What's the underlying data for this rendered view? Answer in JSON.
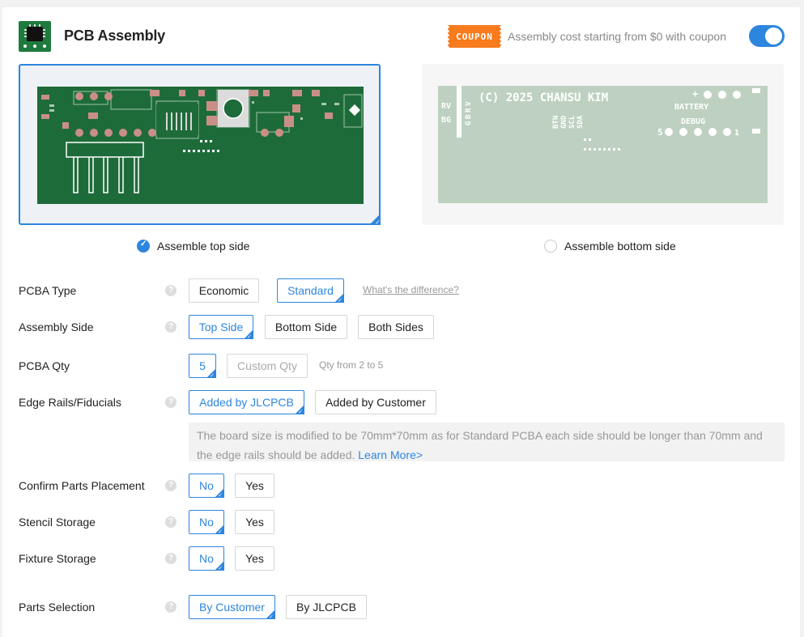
{
  "header": {
    "title": "PCB Assembly",
    "coupon_badge": "COUPON",
    "coupon_text": "Assembly cost starting from $0 with coupon",
    "toggle_on": true,
    "accent_color": "#2d86de",
    "coupon_color": "#f87b1e",
    "board_green": "#1e6b3a"
  },
  "boards": {
    "top_silkscreen": [],
    "bottom_silkscreen": {
      "copyright": "(C) 2025 CHANSU KIM",
      "left_labels": [
        "RV",
        "BG"
      ],
      "side_letters": [
        "V",
        "R",
        "B",
        "G"
      ],
      "vertical_labels": [
        "BTN",
        "GND",
        "SCL",
        "SDA"
      ],
      "battery": "BATTERY",
      "debug": "DEBUG",
      "plus_minus": "+  -",
      "num_left": "5",
      "num_right": "1"
    }
  },
  "side_select": {
    "top_label": "Assemble top side",
    "bottom_label": "Assemble bottom side",
    "selected": "top"
  },
  "form": {
    "pcba_type": {
      "label": "PCBA Type",
      "options": [
        "Economic",
        "Standard"
      ],
      "selected": "Standard",
      "hint": "What's the difference?"
    },
    "assembly_side": {
      "label": "Assembly Side",
      "options": [
        "Top Side",
        "Bottom Side",
        "Both Sides"
      ],
      "selected": "Top Side"
    },
    "pcba_qty": {
      "label": "PCBA Qty",
      "value": "5",
      "custom_placeholder": "Custom Qty",
      "hint": "Qty from 2 to 5"
    },
    "edge_rails": {
      "label": "Edge Rails/Fiducials",
      "options": [
        "Added by JLCPCB",
        "Added by Customer"
      ],
      "selected": "Added by JLCPCB",
      "notice": "The board size is modified to be 70mm*70mm as for Standard PCBA each side should be longer than 70mm and the edge rails should be added.",
      "notice_link": "Learn More>"
    },
    "confirm_parts": {
      "label": "Confirm Parts Placement",
      "options": [
        "No",
        "Yes"
      ],
      "selected": "No"
    },
    "stencil_storage": {
      "label": "Stencil Storage",
      "options": [
        "No",
        "Yes"
      ],
      "selected": "No"
    },
    "fixture_storage": {
      "label": "Fixture Storage",
      "options": [
        "No",
        "Yes"
      ],
      "selected": "No"
    },
    "parts_selection": {
      "label": "Parts Selection",
      "options": [
        "By Customer",
        "By JLCPCB"
      ],
      "selected": "By Customer"
    }
  },
  "help_glyph": "?"
}
